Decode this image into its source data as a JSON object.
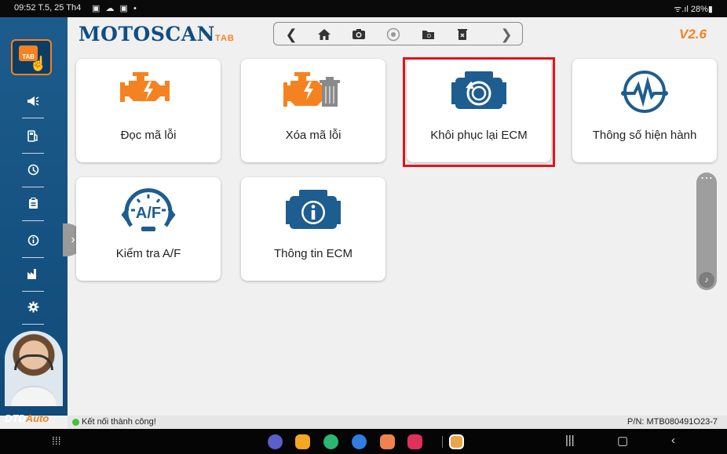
{
  "status_bar": {
    "time": "09:52",
    "date": "T.5, 25 Th4",
    "notif_icons": "▣ ☁ ▣ •",
    "right": "ᯤ.ıl 28%▮"
  },
  "app": {
    "brand": "MOTOSCAN",
    "brand_suffix": "TAB",
    "version": "V2.6"
  },
  "sidebar": {
    "logo": "TAB",
    "items": [
      {
        "name": "megaphone-icon",
        "glyph": "📢"
      },
      {
        "name": "fuel-icon",
        "glyph": "⛽"
      },
      {
        "name": "history-icon",
        "glyph": "⟲"
      },
      {
        "name": "clipboard-icon",
        "glyph": "📋"
      },
      {
        "name": "info-icon",
        "glyph": "ⓘ"
      },
      {
        "name": "factory-icon",
        "glyph": "🏭"
      },
      {
        "name": "gear-icon",
        "glyph": "⚙"
      }
    ],
    "footer_logo_left": "DTD",
    "footer_logo_right": "Auto"
  },
  "toolbar": {
    "back": "❮",
    "home": "⌂",
    "camera": "📷",
    "record": "◉",
    "folder": "▰",
    "delete": "🗑",
    "forward": "❯"
  },
  "functions": [
    {
      "label": "Đọc mã lỗi"
    },
    {
      "label": "Xóa mã lỗi"
    },
    {
      "label": "Khôi phục lại ECM"
    },
    {
      "label": "Thông số hiện hành"
    },
    {
      "label": "Kiểm tra A/F"
    },
    {
      "label": "Thông tin ECM"
    }
  ],
  "af_text": "A/F",
  "status": {
    "connection": "Kết nối thành công!",
    "part_number": "P/N: MTB080491O23-7"
  },
  "colors": {
    "sidebar": "#1c5c8c",
    "brand": "#0f4e83",
    "accent": "#f58220",
    "highlight": "#e0141c",
    "icon": "#1e5d8f"
  }
}
